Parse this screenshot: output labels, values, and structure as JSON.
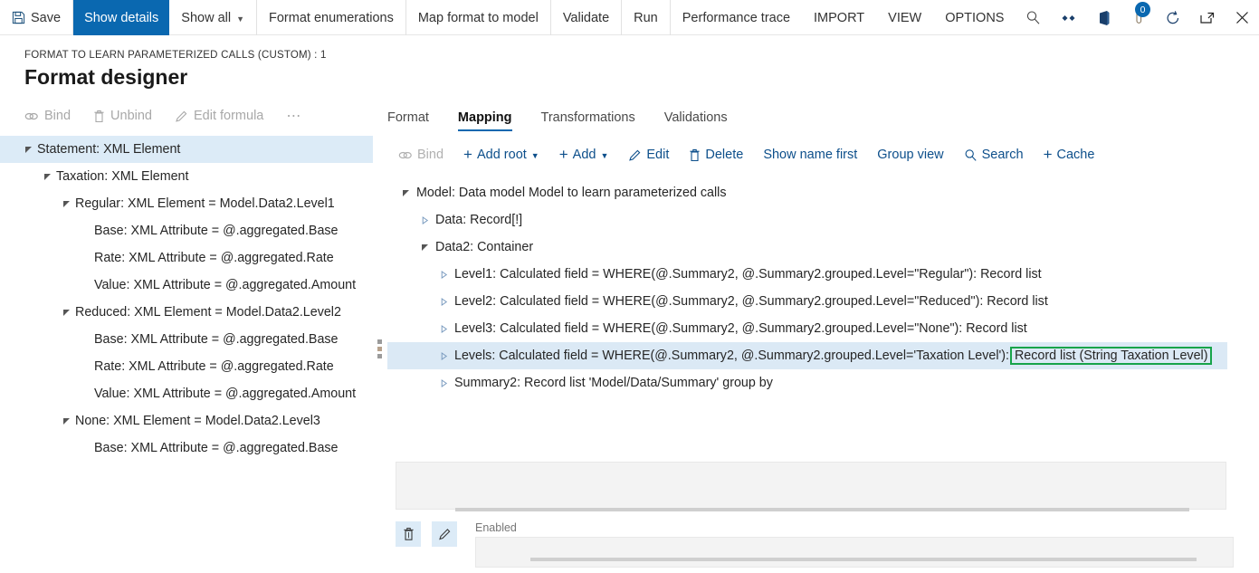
{
  "topbar": {
    "save_label": "Save",
    "items": [
      {
        "label": "Show details",
        "state": "active"
      },
      {
        "label": "Show all",
        "caret": true
      },
      {
        "label": "Format enumerations"
      },
      {
        "label": "Map format to model"
      },
      {
        "label": "Validate"
      },
      {
        "label": "Run"
      },
      {
        "label": "Performance trace"
      },
      {
        "label": "IMPORT"
      },
      {
        "label": "VIEW"
      },
      {
        "label": "OPTIONS"
      }
    ],
    "notification_count": "0",
    "accent_color": "#0a68b0"
  },
  "header": {
    "breadcrumb": "FORMAT TO LEARN PARAMETERIZED CALLS (CUSTOM) : 1",
    "title": "Format designer"
  },
  "left_commands": [
    {
      "label": "Bind",
      "icon": "link-icon",
      "disabled": true
    },
    {
      "label": "Unbind",
      "icon": "trash-icon",
      "disabled": true
    },
    {
      "label": "Edit formula",
      "icon": "pencil-icon",
      "disabled": true
    },
    {
      "label": "⋯",
      "icon": "more-icon",
      "disabled": true
    }
  ],
  "format_tree": [
    {
      "label": "Statement: XML Element",
      "indent": 0,
      "expander": "expanded",
      "selected": true
    },
    {
      "label": "Taxation: XML Element",
      "indent": 1,
      "expander": "expanded",
      "selected": false
    },
    {
      "label": "Regular: XML Element = Model.Data2.Level1",
      "indent": 2,
      "expander": "expanded",
      "selected": false
    },
    {
      "label": "Base: XML Attribute = @.aggregated.Base",
      "indent": 3,
      "expander": "none",
      "selected": false
    },
    {
      "label": "Rate: XML Attribute = @.aggregated.Rate",
      "indent": 3,
      "expander": "none",
      "selected": false
    },
    {
      "label": "Value: XML Attribute = @.aggregated.Amount",
      "indent": 3,
      "expander": "none",
      "selected": false
    },
    {
      "label": "Reduced: XML Element = Model.Data2.Level2",
      "indent": 2,
      "expander": "expanded",
      "selected": false
    },
    {
      "label": "Base: XML Attribute = @.aggregated.Base",
      "indent": 3,
      "expander": "none",
      "selected": false
    },
    {
      "label": "Rate: XML Attribute = @.aggregated.Rate",
      "indent": 3,
      "expander": "none",
      "selected": false
    },
    {
      "label": "Value: XML Attribute = @.aggregated.Amount",
      "indent": 3,
      "expander": "none",
      "selected": false
    },
    {
      "label": "None: XML Element = Model.Data2.Level3",
      "indent": 2,
      "expander": "expanded",
      "selected": false
    },
    {
      "label": "Base: XML Attribute = @.aggregated.Base",
      "indent": 3,
      "expander": "none",
      "selected": false
    }
  ],
  "tabs": [
    {
      "label": "Format",
      "active": false
    },
    {
      "label": "Mapping",
      "active": true
    },
    {
      "label": "Transformations",
      "active": false
    },
    {
      "label": "Validations",
      "active": false
    }
  ],
  "map_commands": [
    {
      "label": "Bind",
      "icon": "link-icon",
      "disabled": true,
      "caret": false,
      "plus": false
    },
    {
      "label": "Add root",
      "icon": "plus-icon",
      "disabled": false,
      "caret": true,
      "plus": true
    },
    {
      "label": "Add",
      "icon": "plus-icon",
      "disabled": false,
      "caret": true,
      "plus": true
    },
    {
      "label": "Edit",
      "icon": "pencil-icon",
      "disabled": false,
      "caret": false,
      "plus": false
    },
    {
      "label": "Delete",
      "icon": "trash-icon",
      "disabled": false,
      "caret": false,
      "plus": false
    },
    {
      "label": "Show name first",
      "icon": "none",
      "disabled": false,
      "caret": false,
      "plus": false
    },
    {
      "label": "Group view",
      "icon": "none",
      "disabled": false,
      "caret": false,
      "plus": false
    },
    {
      "label": "Search",
      "icon": "search-icon",
      "disabled": false,
      "caret": false,
      "plus": false
    },
    {
      "label": "Cache",
      "icon": "plus-icon",
      "disabled": false,
      "caret": false,
      "plus": true
    }
  ],
  "mapping_tree": [
    {
      "label": "Model: Data model Model to learn parameterized calls",
      "indent": 0,
      "expander": "expanded",
      "selected": false
    },
    {
      "label": "Data: Record[!]",
      "indent": 1,
      "expander": "collapsed",
      "selected": false
    },
    {
      "label": "Data2: Container",
      "indent": 1,
      "expander": "expanded",
      "selected": false
    },
    {
      "label": "Level1: Calculated field = WHERE(@.Summary2, @.Summary2.grouped.Level=\"Regular\"): Record list",
      "indent": 2,
      "expander": "collapsed",
      "selected": false
    },
    {
      "label": "Level2: Calculated field = WHERE(@.Summary2, @.Summary2.grouped.Level=\"Reduced\"): Record list",
      "indent": 2,
      "expander": "collapsed",
      "selected": false
    },
    {
      "label": "Level3: Calculated field = WHERE(@.Summary2, @.Summary2.grouped.Level=\"None\"): Record list",
      "indent": 2,
      "expander": "collapsed",
      "selected": false
    },
    {
      "label": "Levels: Calculated field = WHERE(@.Summary2, @.Summary2.grouped.Level='Taxation Level'): ",
      "highlight": "Record list (String Taxation Level)",
      "indent": 2,
      "expander": "collapsed",
      "selected": true
    },
    {
      "label": "Summary2: Record list 'Model/Data/Summary' group by",
      "indent": 2,
      "expander": "collapsed",
      "selected": false
    }
  ],
  "highlight_color": "#18a44a",
  "bottom": {
    "enabled_label": "Enabled",
    "formula_value": "",
    "condition_value": "",
    "delete_icon": "trash-icon",
    "edit_icon": "pencil-icon"
  }
}
